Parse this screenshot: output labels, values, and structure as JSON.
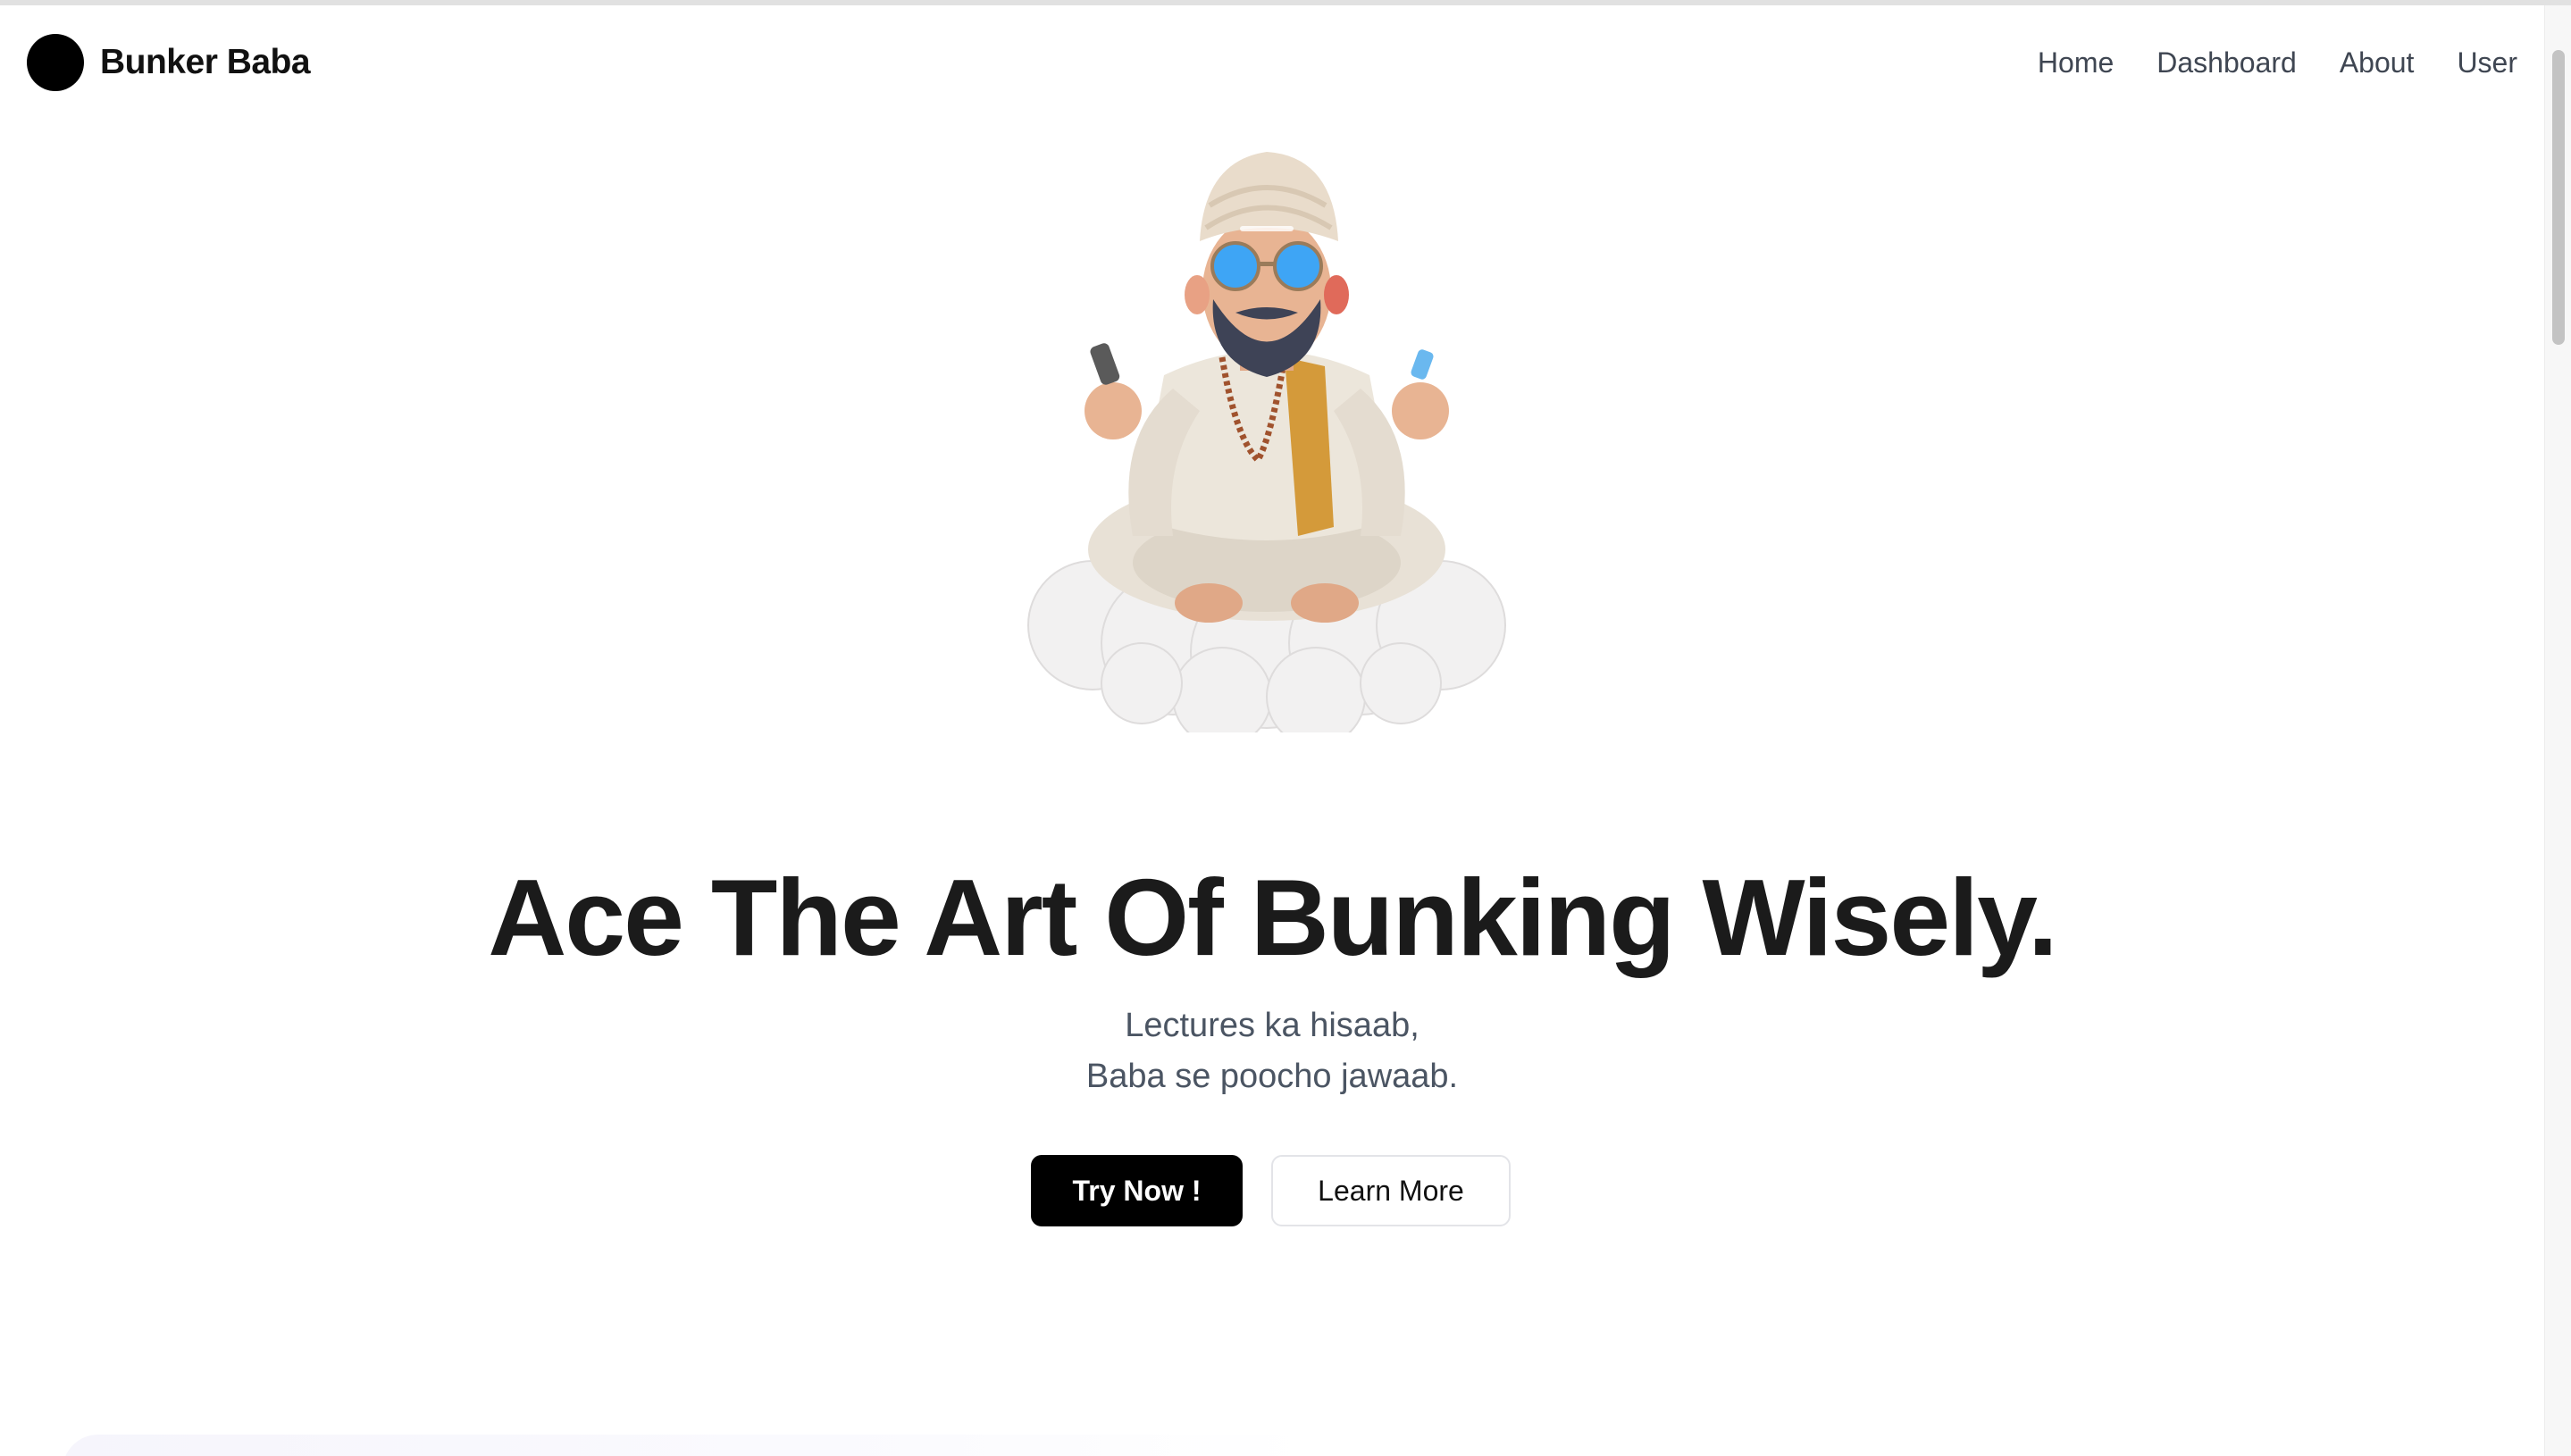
{
  "navbar": {
    "brand_name": "Bunker Baba",
    "links": [
      {
        "label": "Home"
      },
      {
        "label": "Dashboard"
      },
      {
        "label": "About"
      },
      {
        "label": "User"
      }
    ]
  },
  "hero": {
    "image_icon": "baba-on-cloud-illustration",
    "headline": "Ace The Art Of Bunking Wisely.",
    "subtitle_lines": [
      "Lectures ka hisaab,",
      "Baba se poocho jawaab."
    ],
    "primary_button": "Try Now !",
    "secondary_button": "Learn More"
  },
  "colors": {
    "brand": "#000000",
    "text": "#1b1b1b",
    "muted": "#4b5563",
    "turban": "#e9dccb",
    "glasses": "#3ea5f5",
    "cloud": "#f1f0f0",
    "scarf": "#d49a3a"
  }
}
